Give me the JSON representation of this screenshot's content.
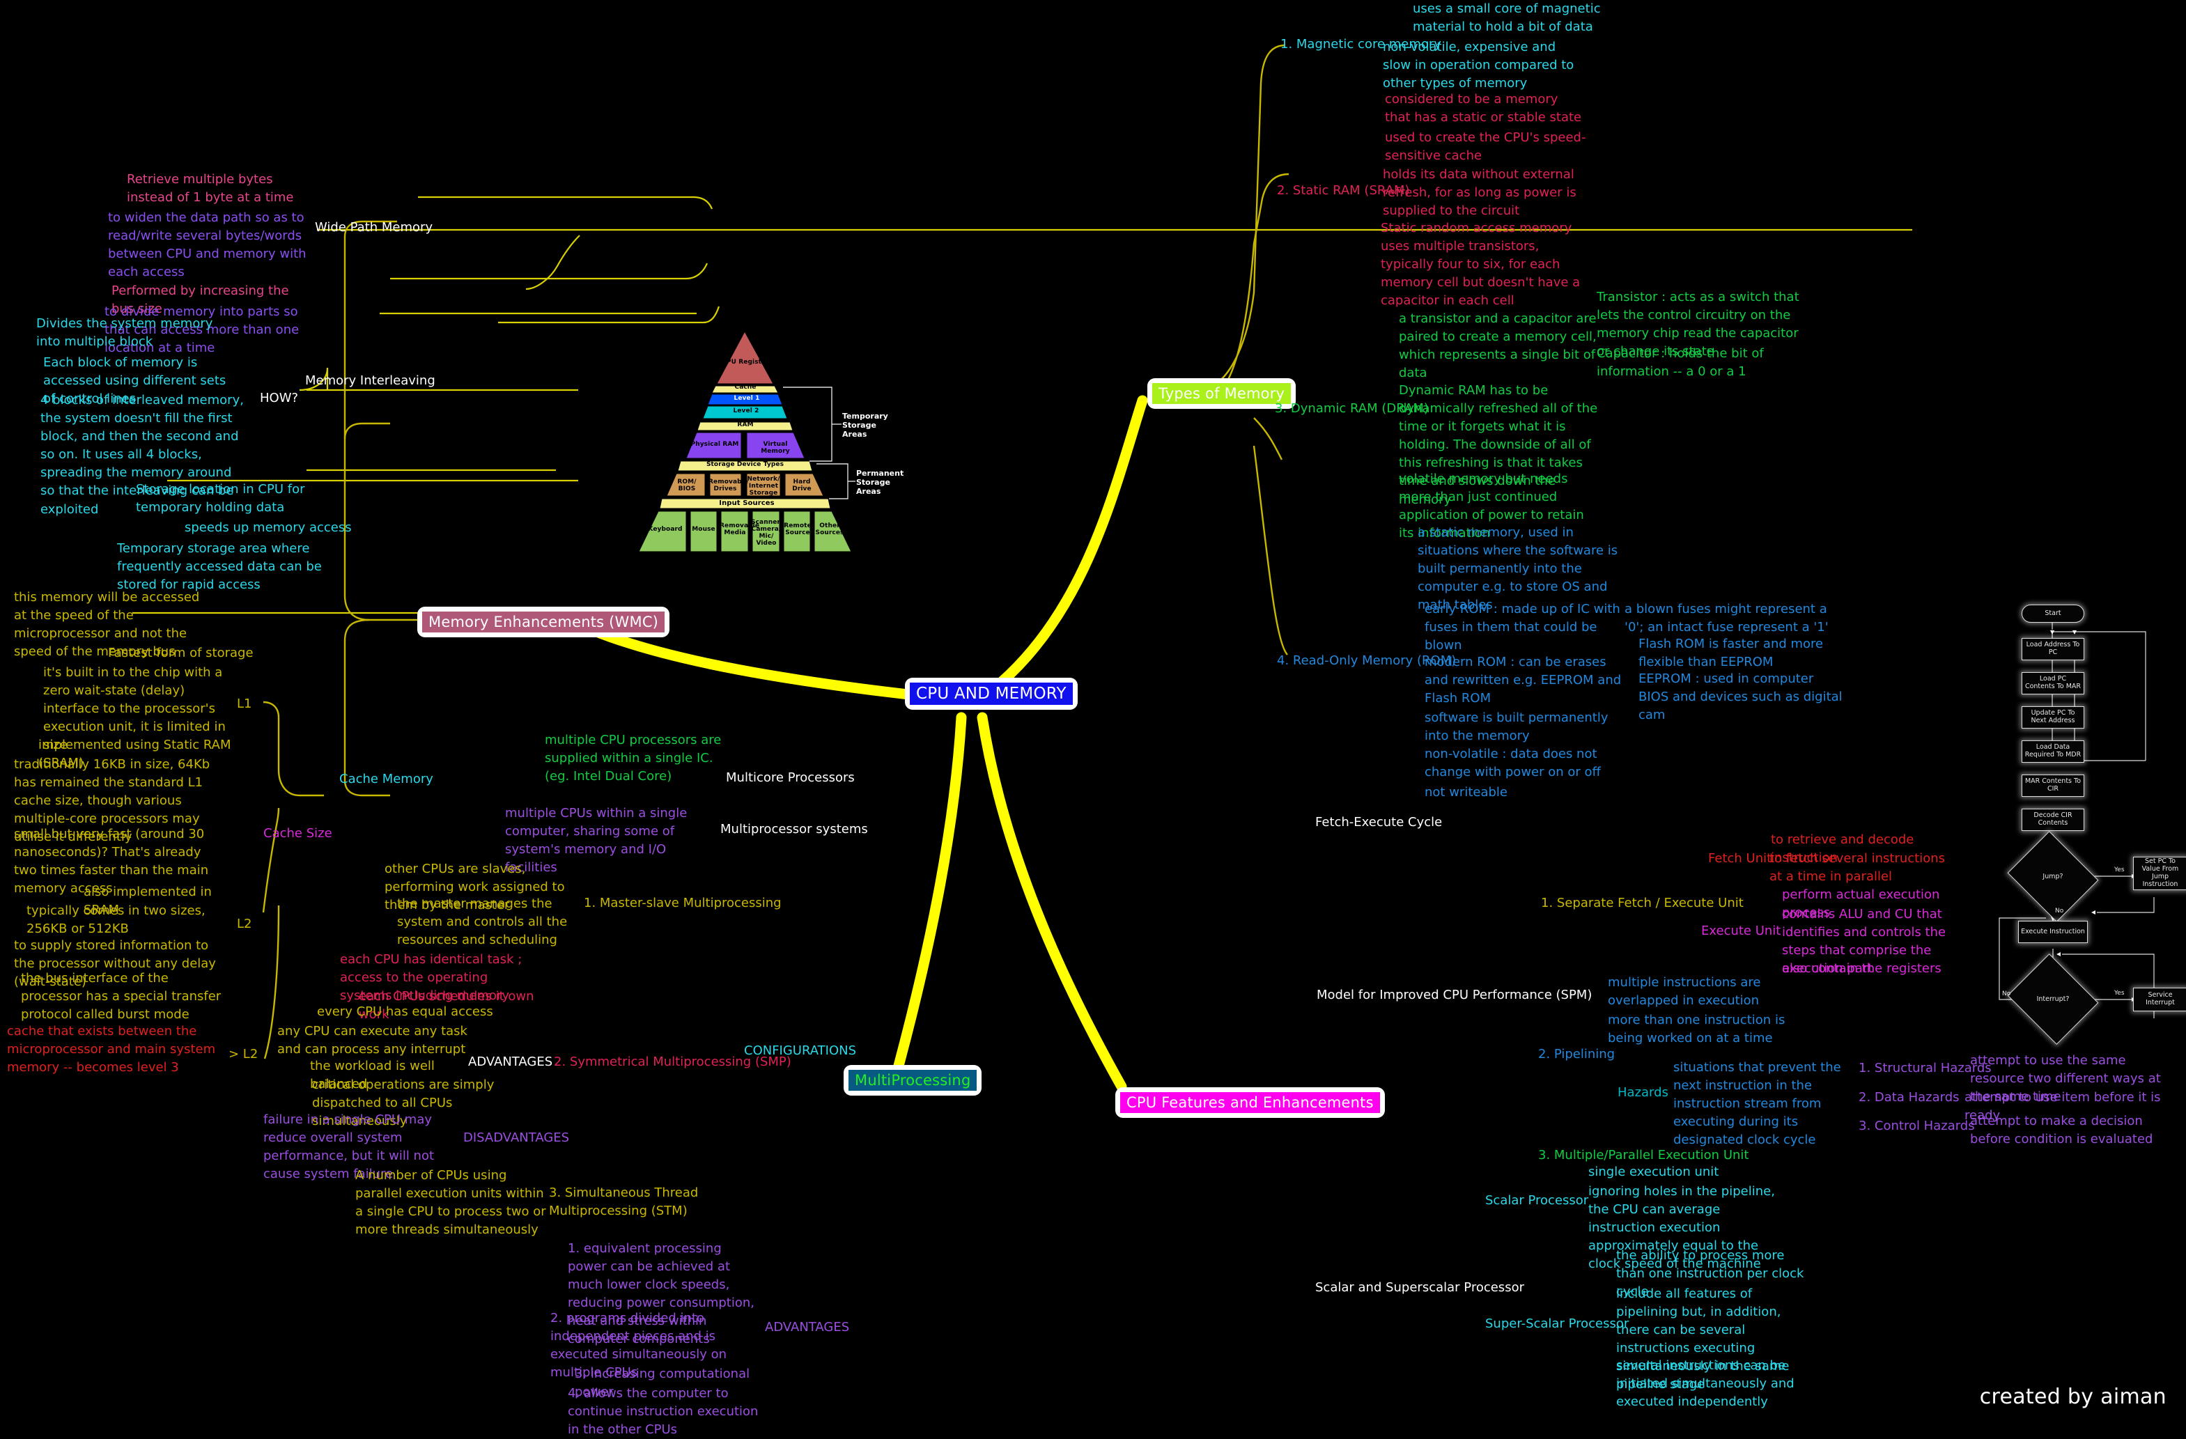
{
  "central": {
    "label": "CPU AND MEMORY"
  },
  "credit": "created by aiman",
  "branches": {
    "memory_enhancements": "Memory Enhancements (WMC)",
    "types_of_memory": "Types of Memory",
    "multiprocessing": "MultiProcessing",
    "cpu_features": "CPU Features and Enhancements"
  },
  "memory_enhancements": {
    "wide_path_memory": {
      "label": "Wide Path Memory",
      "points": [
        "Retrieve multiple bytes instead of 1 byte at a time",
        "to widen the data path so as to read/write several bytes/words between CPU and memory with each access",
        "Performed by increasing the bus size"
      ]
    },
    "memory_interleaving": {
      "label": "Memory Interleaving",
      "points": [
        "to divide memory into parts so that can access more than one location at a time"
      ],
      "how": {
        "label": "HOW?",
        "points": [
          "Divides the system memory into multiple block",
          "Each block of memory is accessed using different sets of control lines",
          "4 blocks of interleaved memory, the system doesn't fill the first block, and then the second and so on. It uses all 4 blocks, spreading the memory around so that the interleaving can be exploited"
        ]
      }
    },
    "cache_memory": {
      "label": "Cache Memory",
      "points": [
        "Storage location in CPU for temporary holding data",
        "speeds up memory access",
        "Temporary storage area where frequently accessed data can be stored for rapid access",
        "this memory will be accessed at the speed of the microprocessor and not the speed of the memory bus"
      ],
      "cache_size": {
        "label": "Cache Size",
        "levels": [
          {
            "label": "L1",
            "points": [
              "Fastest form of storage",
              "it's built in to the chip with a zero wait-state (delay) interface to the processor's execution unit, it is limited in size",
              "implemented using Static RAM (SRAM)",
              "traditionally 16KB in size, 64Kb has remained the standard L1 cache size, though various multiple-core processors may utilise it differently",
              "small but very fast (around 30 nanoseconds)? That's already two times faster than the main memory access"
            ]
          },
          {
            "label": "L2",
            "points": [
              "also implemented in SRAM",
              "typically comes in two sizes, 256KB or 512KB",
              "to supply stored information to the processor without any delay (wait-state)",
              "the bus interface of the processor has a special transfer protocol called burst mode"
            ]
          },
          {
            "label": "> L2",
            "points": [
              "cache that exists between the microprocessor and main system memory -- becomes level 3"
            ]
          }
        ]
      }
    }
  },
  "pyramid": {
    "levels": [
      {
        "name": "CPU Register"
      },
      {
        "name": "Cache",
        "sub": [
          "Level 1",
          "Level 2"
        ]
      },
      {
        "name": "RAM",
        "sub": [
          "Physical RAM",
          "Virtual Memory"
        ]
      },
      {
        "name": "Storage Device Types",
        "sub": [
          "ROM/ BIOS",
          "Removable Drives",
          "Network/ Internet Storage",
          "Hard Drive"
        ]
      },
      {
        "name": "Input Sources",
        "sub": [
          "Keyboard",
          "Mouse",
          "Removable Media",
          "Scanner/ Camera/ Mic/ Video",
          "Remote Source",
          "Other Sources"
        ]
      }
    ],
    "side_labels": [
      "Temporary Storage Areas",
      "Permanent Storage Areas"
    ]
  },
  "types_of_memory": {
    "items": [
      {
        "label": "1. Magnetic core memory",
        "points": [
          "uses a small core of magnetic material to hold a bit of data",
          "non-volatile, expensive and slow in operation compared to other types of memory"
        ]
      },
      {
        "label": "2. Static RAM (SRAM)",
        "points": [
          "considered to be a memory that has a static or stable state",
          "used to create the CPU's speed-sensitive cache",
          "holds its data without external refresh, for as long as power is supplied to the circuit",
          "Static random access memory uses multiple transistors, typically four to six, for each memory cell but doesn't have a capacitor in each cell"
        ]
      },
      {
        "label": "3. Dynamic RAM (DRAM)",
        "points": [
          "a transistor and a capacitor are paired to create a memory cell, which represents a single bit of data",
          "Dynamic RAM has to be dynamically refreshed all of the time or it forgets what it is holding. The downside of all of this refreshing is that it takes time and slows down the memory",
          "volatile memory but needs more than just continued application of power to retain its information"
        ],
        "sub_points": [
          "Transistor : acts as a switch that lets the control circuitry on the memory chip read the capacitor or change its state",
          "Capacitor : holds the bit of information -- a 0 or a 1"
        ]
      },
      {
        "label": "4. Read-Only Memory (ROM)",
        "points": [
          "a static memory, used in situations where the software is built permanently into the computer e.g. to store OS and math tables",
          "early ROM : made up of IC with fuses in them that could be blown",
          "modern ROM : can be erases and rewritten e.g. EEPROM and Flash ROM",
          "software is built permanently into the memory",
          "non-volatile : data does not change with power on or off",
          "not writeable"
        ],
        "sub_points": [
          "a blown fuses might represent a '0'; an intact fuse represent a '1'",
          "Flash ROM is faster and more flexible than EEPROM",
          "EEPROM : used in computer BIOS and devices such as digital cam"
        ]
      }
    ]
  },
  "multiprocessing": {
    "items": [
      {
        "label": "Multicore Processors",
        "points": [
          "multiple CPU processors are supplied within a single IC. (eg. Intel Dual Core)"
        ]
      },
      {
        "label": "Multiprocessor systems",
        "points": [
          "multiple CPUs within a single computer, sharing some of system's memory and I/O facilities"
        ]
      }
    ],
    "configurations": {
      "label": "CONFIGURATIONS",
      "items": [
        {
          "label": "1. Master-slave Multiprocessing",
          "points": [
            "other CPUs are slaves, performing work assigned to them by the master",
            "the master manages the system and controls all the resources and scheduling"
          ]
        },
        {
          "label": "2. Symmetrical Multiprocessing (SMP)",
          "points": [
            "each CPU has identical task ; access to the operating systems including memory",
            "each CPUs schedules it own work"
          ],
          "advantages": {
            "label": "ADVANTAGES",
            "points": [
              "every CPU has equal access",
              "any CPU can execute any task and can process any interrupt",
              "the workload is well balanced",
              "critical operations are simply dispatched to all CPUs simultaneously"
            ]
          },
          "disadvantages": {
            "label": "DISADVANTAGES",
            "points": [
              "failure in a single CPU may reduce overall system performance, but it will not cause system failure"
            ]
          }
        },
        {
          "label": "3. Simultaneous Thread Multiprocessing (STM)",
          "points": [
            "A number of CPUs using parallel execution units within a single CPU to process two or more threads simultaneously"
          ]
        }
      ],
      "advantages": {
        "label": "ADVANTAGES",
        "points": [
          "1. equivalent processing power can be achieved at much lower clock speeds, reducing power consumption, heat and stress within computer components",
          "2. programs divided into independent pieces and is executed simultaneously on multiple CPUs",
          "3. increasing computational power",
          "4. allows the computer to continue instruction execution in the other CPUs"
        ]
      }
    }
  },
  "cpu_features": {
    "fetch_execute_cycle": "Fetch-Execute Cycle",
    "spm": {
      "label": "Model for Improved CPU Performance (SPM)",
      "items": [
        {
          "label": "1. Separate Fetch / Execute Unit",
          "units": [
            {
              "label": "Fetch Unit",
              "points": [
                "to retrieve and decode instruction",
                "to fetch several instructions at a time in parallel"
              ]
            },
            {
              "label": "Execute Unit",
              "points": [
                "perform actual execution process",
                "contains ALU and CU that identifies and controls the steps that comprise the execution part",
                "also contain the registers"
              ]
            }
          ]
        },
        {
          "label": "2. Pipelining",
          "points": [
            "multiple instructions are overlapped in execution",
            "more than one instruction is being worked on at a time"
          ],
          "hazards": {
            "label": "Hazards",
            "description": "situations that prevent the next instruction in the instruction stream from executing during its designated clock cycle",
            "types": [
              {
                "label": "1. Structural Hazards",
                "detail": "attempt to use the same resource two different ways at the same time"
              },
              {
                "label": "2. Data Hazards",
                "detail": "attempt to use item before it is ready"
              },
              {
                "label": "3. Control Hazards",
                "detail": "attempt to make a decision before condition is evaluated"
              }
            ]
          }
        },
        {
          "label": "3. Multiple/Parallel Execution Unit"
        }
      ]
    },
    "scalar": {
      "label": "Scalar and Superscalar Processor",
      "items": [
        {
          "label": "Scalar Processor",
          "points": [
            "single execution unit",
            "ignoring holes in the pipeline, the CPU can average instruction execution approximately equal to the clock speed of the machine"
          ]
        },
        {
          "label": "Super-Scalar Processor",
          "points": [
            "the ability to process more than one instruction per clock cycle",
            "include all features of pipelining but, in addition, there can be several instructions executing simultaneously in the same pipeline stage",
            "several instructions can be initiated simultaneously and executed independently"
          ]
        }
      ]
    }
  },
  "flowchart": {
    "nodes": [
      "Start",
      "Load Address To PC",
      "Load PC Contents To MAR",
      "Update PC To Next Address",
      "Load Data Required To MDR",
      "MAR Contents To CIR",
      "Decode CIR Contents",
      "Jump?",
      "Set PC To Value From Jump Instruction",
      "Execute Instruction",
      "Interrupt?",
      "Service Interrupt"
    ],
    "edge_labels": [
      "Yes",
      "No",
      "No",
      "Yes"
    ]
  }
}
